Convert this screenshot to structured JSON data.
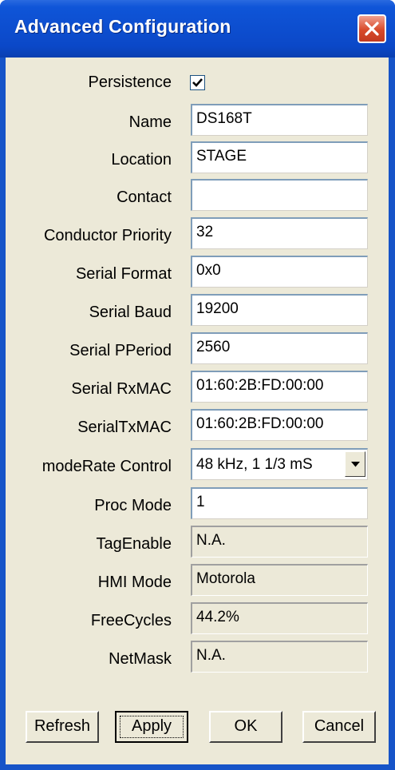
{
  "window": {
    "title": "Advanced Configuration",
    "close_icon": "close-icon"
  },
  "form": {
    "persistence": {
      "label": "Persistence",
      "checked": true
    },
    "fields": [
      {
        "label": "Name",
        "value": "DS168T",
        "readonly": false
      },
      {
        "label": "Location",
        "value": "STAGE",
        "readonly": false
      },
      {
        "label": "Contact",
        "value": "",
        "readonly": false
      },
      {
        "label": "Conductor Priority",
        "value": "32",
        "readonly": false
      },
      {
        "label": "Serial Format",
        "value": "0x0",
        "readonly": false
      },
      {
        "label": "Serial Baud",
        "value": "19200",
        "readonly": false
      },
      {
        "label": "Serial PPeriod",
        "value": "2560",
        "readonly": false
      },
      {
        "label": "Serial RxMAC",
        "value": "01:60:2B:FD:00:00",
        "readonly": false
      },
      {
        "label": "SerialTxMAC",
        "value": "01:60:2B:FD:00:00",
        "readonly": false
      }
    ],
    "mode_rate": {
      "label": "modeRate Control",
      "value": "48 kHz, 1 1/3 mS"
    },
    "more_fields": [
      {
        "label": "Proc Mode",
        "value": "1",
        "readonly": false
      },
      {
        "label": "TagEnable",
        "value": "N.A.",
        "readonly": true
      },
      {
        "label": "HMI Mode",
        "value": "Motorola",
        "readonly": true
      },
      {
        "label": "FreeCycles",
        "value": "44.2%",
        "readonly": true
      },
      {
        "label": "NetMask",
        "value": "N.A.",
        "readonly": true
      }
    ]
  },
  "buttons": {
    "refresh": "Refresh",
    "apply": "Apply",
    "ok": "OK",
    "cancel": "Cancel"
  },
  "colors": {
    "titlebar": "#0b48c8",
    "dialog_bg": "#ece9d8",
    "close_button": "#d84a2a"
  }
}
